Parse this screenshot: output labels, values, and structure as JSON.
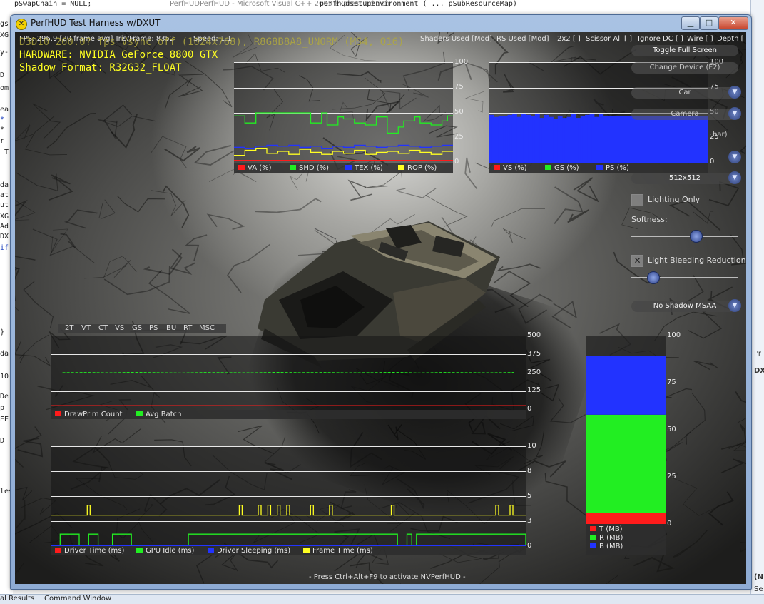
{
  "ide": {
    "top_text": "pSwapChain = NULL;",
    "top_text2": "PerfHUDPerfHUD - Microsoft Visual C++ 2005 Express Edition",
    "top_right_text": "perfhudsetupenvironment ( ... pSubResourceMap)",
    "left_fragments": [
      "gs",
      "XG",
      "y-",
      "D",
      "om",
      "ea",
      "*",
      "*",
      "r",
      "_T",
      "da",
      "at",
      "ut",
      "XG",
      "Ad",
      "DX",
      "if",
      "}",
      "da",
      "10",
      "De",
      "p",
      "EE",
      "D",
      "les"
    ],
    "right_fragments": [
      "Pr",
      "DX",
      "(N",
      "Se"
    ],
    "bottom_tabs": [
      "al Results",
      "Command Window"
    ]
  },
  "window": {
    "title": "PerfHUD Test Harness w/DXUT",
    "minimize": "▁",
    "maximize": "□",
    "close": "✕"
  },
  "hud": {
    "stats": {
      "fps": "FPS: 296.9 [20 frame avg]",
      "tris": "Tris/Frame:   8352",
      "speed": "Speed:  1.1"
    },
    "options": {
      "shaders": "Shaders Used [Mod]",
      "rs": "RS Used [Mod]",
      "x2": "2x2 [ ]",
      "scissor": "Scissor All [ ]",
      "ignore_dc": "Ignore DC [ ]",
      "wire": "Wire [ ]",
      "depth": "Depth [ ]"
    },
    "ghost_line": "D3D10 200.0? fps Vsync off (1024x768), R8G8B8A8_UNORM (MS4, Q16)",
    "hardware": "HARDWARE: NVIDIA GeForce 8800 GTX",
    "shadow_format": "Shadow Format: R32G32_FLOAT",
    "footer": "- Press Ctrl+Alt+F9 to activate NVPerfHUD -"
  },
  "graphs": {
    "unit_graph": {
      "ticks": [
        "100",
        "75",
        "50",
        "25",
        "0"
      ],
      "ymax": 100,
      "legend": [
        {
          "label": "VA (%)",
          "color": "#ff1b1b"
        },
        {
          "label": "SHD (%)",
          "color": "#22ee22"
        },
        {
          "label": "TEX (%)",
          "color": "#2233ff"
        },
        {
          "label": "ROP (%)",
          "color": "#ffff22"
        }
      ],
      "series": {
        "VA": [
          3,
          3,
          3,
          3,
          3,
          3,
          3,
          3,
          3,
          3,
          3,
          3,
          3,
          3,
          3,
          3,
          3,
          3,
          3,
          3,
          3,
          3,
          3,
          3,
          3,
          3,
          3,
          3,
          3,
          3,
          3,
          3,
          3,
          3,
          3,
          3,
          3,
          3,
          3,
          3
        ],
        "SHD": [
          47,
          47,
          40,
          40,
          50,
          50,
          50,
          50,
          50,
          50,
          50,
          50,
          50,
          50,
          40,
          40,
          50,
          38,
          38,
          46,
          44,
          44,
          40,
          40,
          38,
          38,
          46,
          46,
          30,
          30,
          36,
          42,
          42,
          46,
          40,
          40,
          38,
          38,
          42,
          47
        ],
        "TEX": [
          16,
          16,
          15,
          15,
          17,
          17,
          18,
          18,
          17,
          17,
          18,
          18,
          16,
          16,
          17,
          17,
          15,
          15,
          17,
          17,
          16,
          16,
          18,
          18,
          17,
          17,
          16,
          16,
          17,
          17,
          18,
          18,
          17,
          17,
          16,
          16,
          17,
          17,
          18,
          18
        ],
        "ROP": [
          8,
          8,
          13,
          13,
          15,
          15,
          10,
          10,
          12,
          12,
          9,
          9,
          14,
          14,
          11,
          11,
          9,
          9,
          12,
          12,
          10,
          10,
          13,
          13,
          9,
          9,
          11,
          11,
          12,
          12,
          10,
          10,
          13,
          13,
          11,
          11,
          9,
          9,
          12,
          12
        ]
      }
    },
    "shader_graph": {
      "ticks": [
        "100",
        "75",
        "50",
        "25",
        "0"
      ],
      "ymax": 100,
      "legend": [
        {
          "label": "VS (%)",
          "color": "#ff1b1b"
        },
        {
          "label": "GS (%)",
          "color": "#22ee22"
        },
        {
          "label": "PS (%)",
          "color": "#2233ff"
        }
      ],
      "series": {
        "PS": [
          48,
          48,
          46,
          46,
          47,
          47,
          47,
          47,
          48,
          48,
          50,
          50,
          46,
          46,
          49,
          49,
          48,
          48,
          47,
          47,
          49,
          49,
          45,
          45,
          48,
          48,
          46,
          46,
          44,
          44,
          47,
          47,
          45,
          45,
          46,
          46,
          49,
          49,
          45,
          45,
          47,
          47,
          48,
          48,
          50,
          50,
          46,
          46,
          49,
          49
        ]
      }
    },
    "batch_graph": {
      "ticks": [
        "500",
        "375",
        "250",
        "125",
        "0"
      ],
      "ymax": 500,
      "legend": [
        {
          "label": "DrawPrim Count",
          "color": "#ff1b1b"
        },
        {
          "label": "Avg Batch",
          "color": "#22ee22"
        }
      ],
      "series": {
        "DrawPrim": [
          28,
          28,
          28,
          28,
          28,
          28,
          28,
          28,
          28,
          28,
          28,
          28,
          28,
          28,
          28,
          28,
          28,
          28,
          28,
          28
        ],
        "AvgBatch": [
          250,
          251,
          249,
          252,
          250,
          248,
          251,
          250,
          249,
          252,
          250,
          251,
          249,
          250,
          252,
          248,
          251,
          250,
          249,
          251
        ]
      }
    },
    "time_graph": {
      "ticks": [
        "10",
        "8",
        "5",
        "3",
        "0"
      ],
      "ymax": 10,
      "legend": [
        {
          "label": "Driver Time (ms)",
          "color": "#ff1b1b"
        },
        {
          "label": "GPU Idle (ms)",
          "color": "#22ee22"
        },
        {
          "label": "Driver Sleeping (ms)",
          "color": "#2233ff"
        },
        {
          "label": "Frame Time (ms)",
          "color": "#ffff22"
        }
      ],
      "frame_time_base": 3.1,
      "frame_time_spikes": [
        0.08,
        0.4,
        0.44,
        0.46,
        0.48,
        0.5,
        0.55,
        0.59,
        0.72,
        0.94,
        0.97
      ],
      "frame_time_spike_value": 4.1,
      "gpu_idle_segments": [
        [
          0.02,
          0.06
        ],
        [
          0.08,
          0.1
        ],
        [
          0.13,
          0.17
        ],
        [
          0.29,
          0.73
        ],
        [
          0.75,
          0.76
        ],
        [
          0.77,
          1.0
        ]
      ],
      "gpu_idle_value": 1.2
    },
    "memory_bar": {
      "ticks": [
        "100",
        "75",
        "50",
        "25",
        "0"
      ],
      "ymax": 100,
      "legend": [
        {
          "label": "T (MB)",
          "color": "#ff1b1b"
        },
        {
          "label": "R (MB)",
          "color": "#22ee22"
        },
        {
          "label": "B (MB)",
          "color": "#2233ff"
        }
      ],
      "stack": [
        {
          "name": "T",
          "value": 6,
          "color": "#ff1b1b"
        },
        {
          "name": "R",
          "value": 52,
          "color": "#22ee22"
        },
        {
          "name": "B",
          "value": 31,
          "color": "#2233ff"
        }
      ]
    }
  },
  "tabs": [
    "2T",
    "VT",
    "CT",
    "VS",
    "GS",
    "PS",
    "BU",
    "RT",
    "MSC"
  ],
  "controls": {
    "toggle_full_screen": "Toggle Full Screen",
    "change_device": "Change Device (F2)",
    "car": "Car",
    "camera": "Camera",
    "partial_label": "bar)",
    "map_size": "512x512",
    "lighting_only": "Lighting Only",
    "softness": "Softness:",
    "softness_value": 0.6,
    "light_bleeding": "Light Bleeding Reduction:",
    "light_bleeding_value": 0.2,
    "light_bleeding_checked": "✕",
    "shadow_msaa": "No Shadow MSAA",
    "dropdown_glyph": "▼"
  }
}
